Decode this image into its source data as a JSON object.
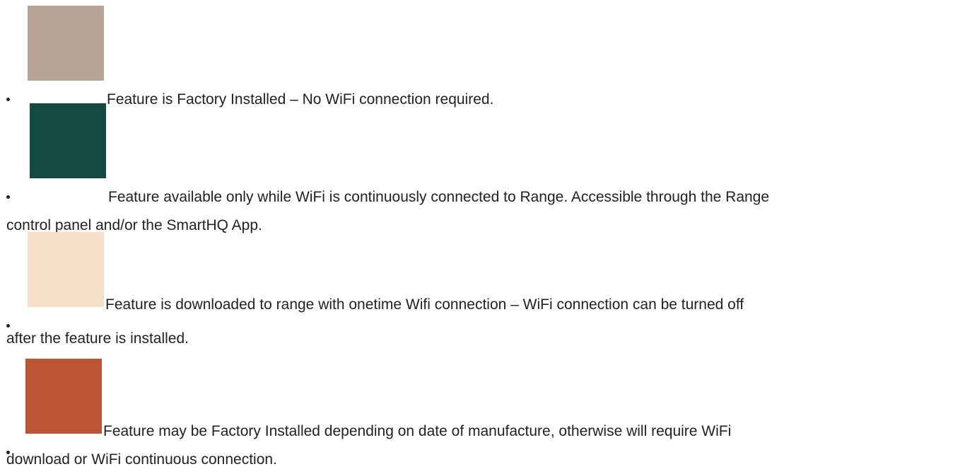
{
  "legend": {
    "items": [
      {
        "color": "#b8a494",
        "line1": "Feature is Factory Installed – No WiFi connection required.",
        "line2": ""
      },
      {
        "color": "#154a40",
        "line1": "Feature available only while WiFi is continuously connected to Range. Accessible through the Range",
        "line2": "control panel and/or the SmartHQ App."
      },
      {
        "color": "#f7dfc9",
        "line1": "Feature is downloaded to range with onetime Wifi connection – WiFi connection can be turned off",
        "line2": "after the feature is installed."
      },
      {
        "color": "#bb5533",
        "line1": "Feature may be Factory Installed depending on date of manufacture, otherwise will require WiFi",
        "line2": "download or WiFi continuous connection."
      }
    ]
  }
}
